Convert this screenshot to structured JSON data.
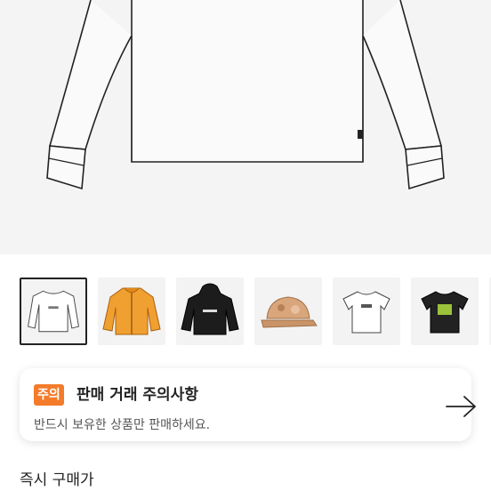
{
  "product_image": {
    "alt_icon": "sweatshirt-flat-sketch"
  },
  "thumbnails": [
    {
      "name": "sweatshirt-white",
      "selected": true
    },
    {
      "name": "jacket-orange",
      "selected": false
    },
    {
      "name": "hoodie-black",
      "selected": false
    },
    {
      "name": "cap-camo",
      "selected": false
    },
    {
      "name": "tshirt-white",
      "selected": false
    },
    {
      "name": "tshirt-black",
      "selected": false
    }
  ],
  "notice": {
    "badge": "주의",
    "title": "판매 거래 주의사항",
    "description": "반드시 보유한 상품만 판매하세요.",
    "arrow_icon": "arrow-right-icon",
    "badge_color": "#f47b2a"
  },
  "section": {
    "title": "즉시 구매가"
  }
}
